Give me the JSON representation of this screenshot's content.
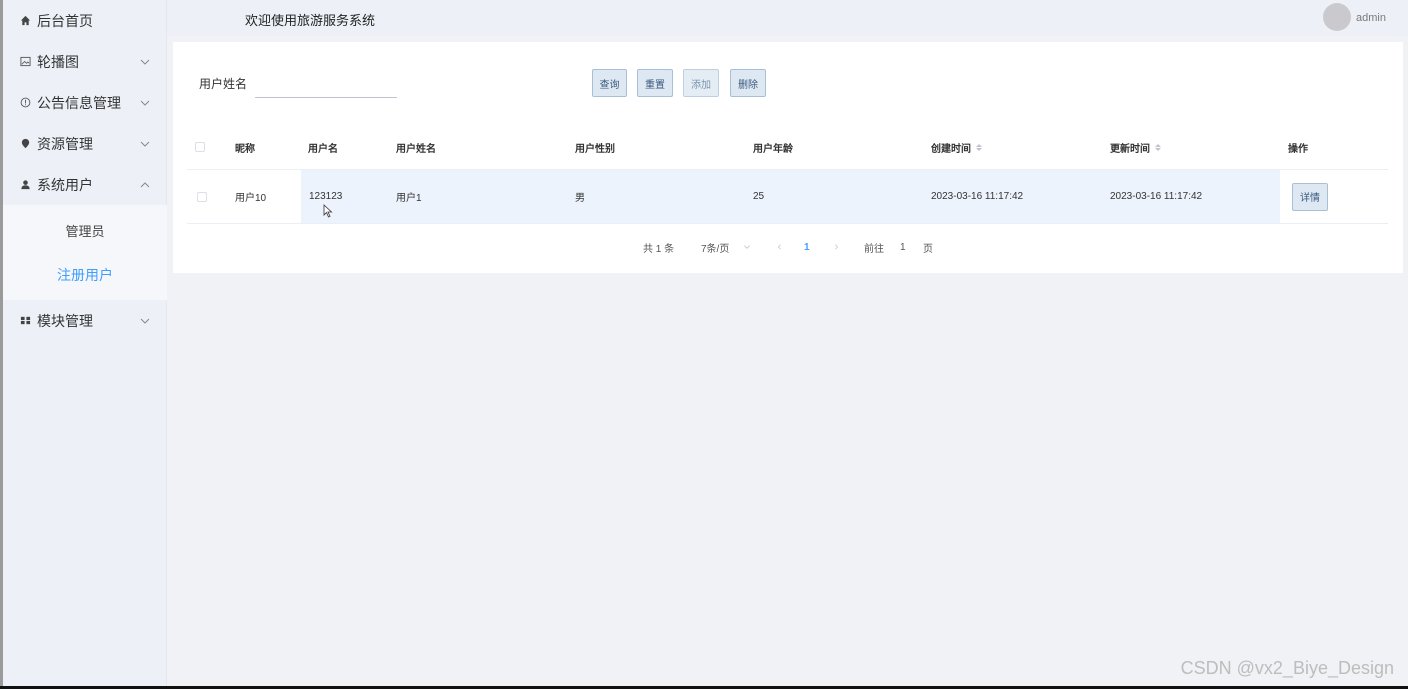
{
  "header": {
    "title": "欢迎使用旅游服务系统",
    "user_name": "admin"
  },
  "sidebar": {
    "items": [
      {
        "label": "后台首页",
        "icon": "home-icon",
        "has_children": false
      },
      {
        "label": "轮播图",
        "icon": "picture-icon",
        "has_children": true,
        "expanded": false
      },
      {
        "label": "公告信息管理",
        "icon": "info-circle-icon",
        "has_children": true,
        "expanded": false
      },
      {
        "label": "资源管理",
        "icon": "location-pin-icon",
        "has_children": true,
        "expanded": false
      },
      {
        "label": "系统用户",
        "icon": "user-icon",
        "has_children": true,
        "expanded": true
      },
      {
        "label": "模块管理",
        "icon": "grid-icon",
        "has_children": true,
        "expanded": false
      }
    ],
    "sub_items": [
      {
        "label": "管理员",
        "active": false
      },
      {
        "label": "注册用户",
        "active": true
      }
    ]
  },
  "search": {
    "label": "用户姓名",
    "value": "",
    "placeholder": ""
  },
  "toolbar": {
    "query_label": "查询",
    "reset_label": "重置",
    "add_label": "添加",
    "delete_label": "删除"
  },
  "table": {
    "columns": [
      "昵称",
      "用户名",
      "用户姓名",
      "用户性别",
      "用户年龄",
      "创建时间",
      "更新时间",
      "操作"
    ],
    "rows": [
      {
        "nickname": "用户10",
        "username": "123123",
        "realname": "用户1",
        "gender": "男",
        "age": "25",
        "created": "2023-03-16 11:17:42",
        "updated": "2023-03-16 11:17:42",
        "action": "详情"
      }
    ]
  },
  "pagination": {
    "total": "共 1 条",
    "page_size": "7条/页",
    "current_page": "1",
    "goto_prefix": "前往",
    "goto_value": "1",
    "goto_suffix": "页"
  },
  "watermark": "CSDN @vx2_Biye_Design",
  "colors": {
    "accent": "#409eff",
    "sidebar_bg": "#edf1f7",
    "button_bg": "#dde8f3",
    "button_border": "#a9bfd6"
  }
}
